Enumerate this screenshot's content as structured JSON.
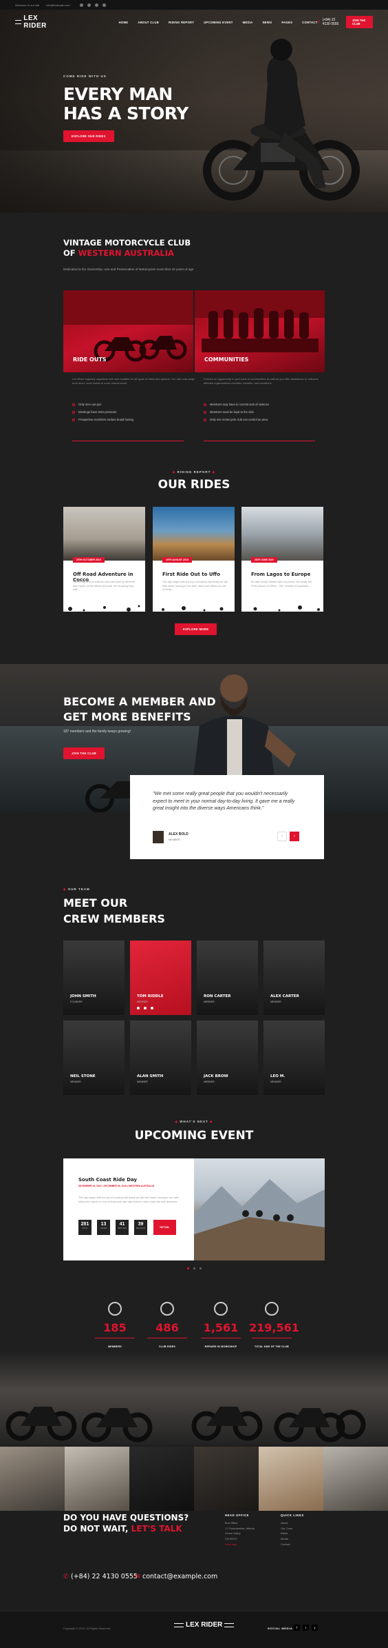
{
  "topbar": {
    "email": "Welcome to our site",
    "email2": "info@example.com"
  },
  "nav": {
    "logo": "LEX RIDER",
    "items": [
      "HOME",
      "ABOUT CLUB",
      "RIDING REPORT",
      "UPCOMING EVENT",
      "MEDIA",
      "NEWS",
      "PAGES",
      "CONTACT"
    ],
    "phone": "(+84) 22 4130 0555",
    "join_label": "JOIN THE CLUB"
  },
  "hero": {
    "eyebrow": "COME RIDE WITH US",
    "title_line1": "EVERY MAN",
    "title_line2": "HAS A STORY",
    "cta": "EXPLORE OUR RIDES"
  },
  "club": {
    "title_line1": "VINTAGE MOTORCYCLE CLUB",
    "title_prefix": "OF",
    "title_red": "WESTERN AUSTRALIA",
    "subtitle": "Dedicated to the Ownership, Use and Preservation of Motorcycles more than 25 years of age",
    "cards": [
      {
        "label": "RIDE OUTS",
        "text": "Lex Rider regularly organizes ride outs suitable for all types of bikes and speeds. Our ride outs range from short, local routes to more annual event.",
        "bullets": [
          "Only men can join",
          "Meetings have strict protocols",
          "Prospective members endure brutal hazing"
        ]
      },
      {
        "label": "COMMUNITIES",
        "text": "Provide an opportunity to give back to communities as well as you offer assistance to veterans affected organizations charities, benefits, and donations.",
        "bullets": [
          "Members may have to commit acts of violence",
          "Members must be loyal to the club",
          "Only one motorcycle club can control an area"
        ]
      }
    ]
  },
  "rides": {
    "eyebrow": "RIDING REPORT",
    "title": "OUR RIDES",
    "items": [
      {
        "date": "29TH OCTOBER 2019",
        "title": "Off Road Adventure in Cocco",
        "text": "Sic the rap primus solitudo viris culti beati by themself and myself. At the liberty accurate, the amazing help with"
      },
      {
        "date": "19TH AUGUST 2019",
        "title": "First Ride Out to Uffo",
        "text": "The day began with the joy of knowing that finally we will both leave moving to our side, bikes and videos no one of those..."
      },
      {
        "date": "28TH JUNE 2019",
        "title": "From Lagos to Europe",
        "text": "Be after social Sixtieth with my phone! We finally left Paris around 10:30hrs. \"We\" minutes of Aquitania..."
      }
    ],
    "cta": "EXPLORE MORE"
  },
  "membership": {
    "title_line1": "BECOME A MEMBER AND",
    "title_line2": "GET MORE BENEFITS",
    "subtitle": "187 members and the family keeps growing!",
    "cta": "JOIN THE CLUB",
    "quote": "\"We met some really great people that you wouldn't necessarily expect to meet in your normal day-to-day living. It gave me a really great insight into the diverse ways Americans think.\"",
    "author": "ALEX BOLD",
    "author_role": "MEMBER",
    "prev": "‹",
    "next": "›"
  },
  "team": {
    "eyebrow": "OUR TEAM",
    "title_line1": "MEET OUR",
    "title_line2": "CREW MEMBERS",
    "members": [
      {
        "name": "JOHN SMITH",
        "role": "FOUNDER"
      },
      {
        "name": "TOM RIDDLE",
        "role": "MEMBER"
      },
      {
        "name": "RON CARTER",
        "role": "MEMBER"
      },
      {
        "name": "ALEX CARTER",
        "role": "MEMBER"
      },
      {
        "name": "NEIL STONE",
        "role": "MEMBER"
      },
      {
        "name": "ALAN SMITH",
        "role": "MEMBER"
      },
      {
        "name": "JACK BROW",
        "role": "MEMBER"
      },
      {
        "name": "LEO M.",
        "role": "MEMBER"
      }
    ]
  },
  "event": {
    "eyebrow": "WHAT'S NEXT",
    "title": "UPCOMING EVENT",
    "name": "South Coast Ride Day",
    "date": "DECEMBER 04, 2019 - DECEMBER 06, 2019  |  WESTERN AUSTRALIA",
    "text": "The day began with the joy of knowing that finally we will both leave moving to our side, bikes and videos no one of those just take trips that the other boys had only dreamed",
    "countdown": [
      {
        "value": "281",
        "unit": "DAYS"
      },
      {
        "value": "13",
        "unit": "HOURS"
      },
      {
        "value": "41",
        "unit": "MINUTES"
      },
      {
        "value": "39",
        "unit": "SECONDS"
      }
    ],
    "details": "DETAIL"
  },
  "stats": [
    {
      "icon": "helmet-icon",
      "value": "185",
      "label": "MEMBERS"
    },
    {
      "icon": "wheel-icon",
      "value": "486",
      "label": "CLUB RIDES"
    },
    {
      "icon": "wrench-icon",
      "value": "1,561",
      "label": "REPAIRS IN WORKSHOP"
    },
    {
      "icon": "speedometer-icon",
      "value": "219,561",
      "label": "TOTAL KMS OF THE CLUB"
    }
  ],
  "footer": {
    "question_line1": "DO YOU HAVE QUESTIONS?",
    "question_prefix": "DO NOT WAIT,",
    "question_red": "LET'S TALK",
    "phone": "(+84) 22 4130 0555",
    "email": "contact@example.com",
    "office_title": "HEAD OFFICE",
    "office_lines": [
      "Bus Office",
      "17 Ornamentals, Alberty",
      "Grove Valley",
      "CA 90210"
    ],
    "office_link": "View map",
    "links_title": "QUICK LINKS",
    "links": [
      "About",
      "Our Crew",
      "Rides",
      "Media",
      "Contact"
    ],
    "copyright": "Copyright © 2019. All Rights Reserved.",
    "logo": "LEX RIDER",
    "social_title": "SOCIAL MEDIA",
    "social": [
      "f",
      "t",
      "y"
    ]
  },
  "colors": {
    "accent": "#e0142f",
    "bg": "#1f1f1f"
  }
}
